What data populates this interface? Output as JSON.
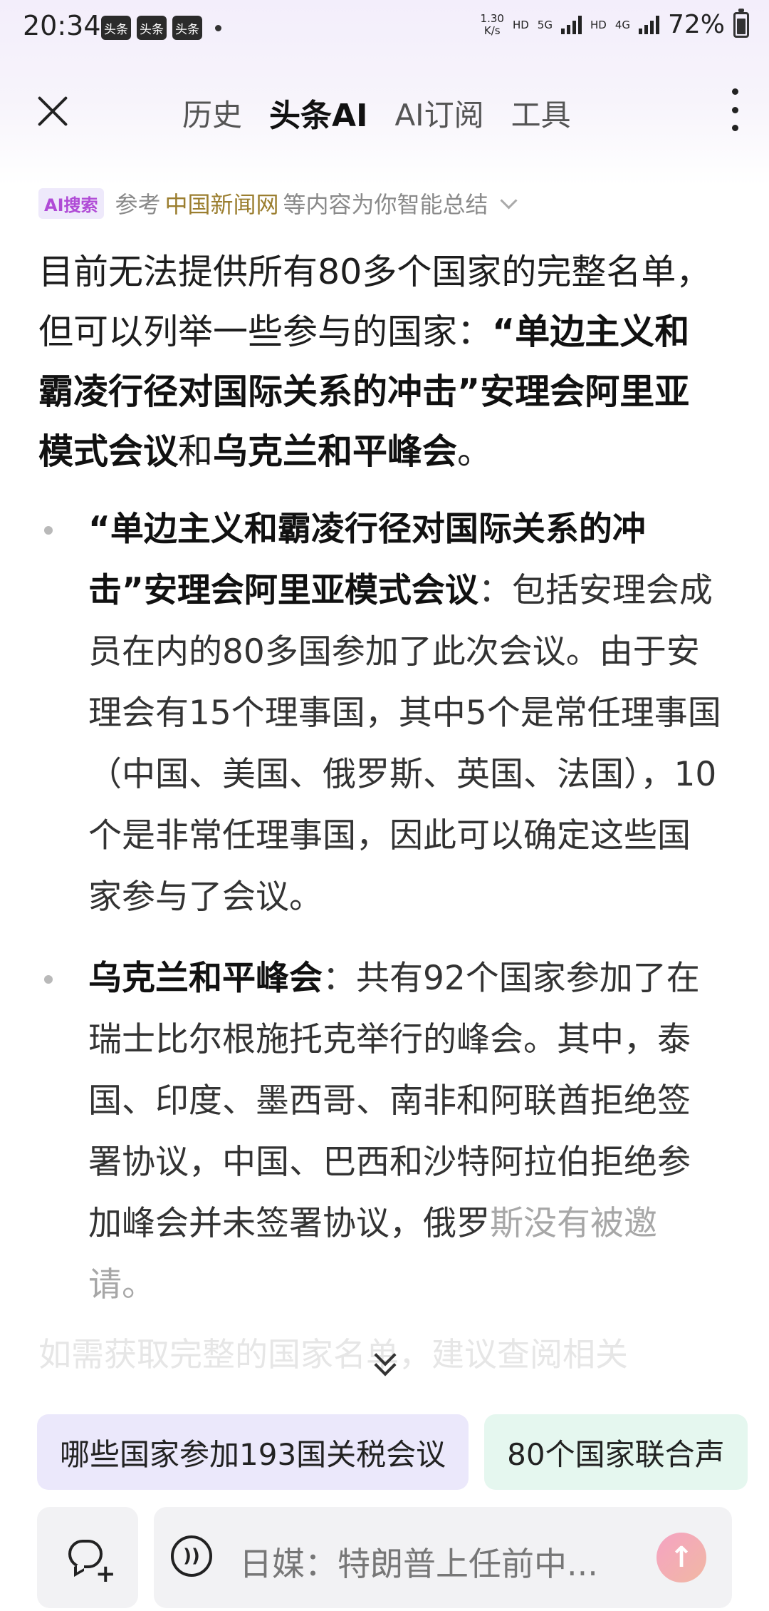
{
  "status": {
    "time": "20:34",
    "apps": [
      "头条",
      "头条",
      "头条"
    ],
    "net_speed_value": "1.30",
    "net_speed_unit": "K/s",
    "hd1": "HD",
    "sig1": "5G",
    "hd2": "HD",
    "sig2": "4G",
    "battery": "72%"
  },
  "nav": {
    "tabs": [
      "历史",
      "头条AI",
      "AI订阅",
      "工具"
    ],
    "active_tab": "头条AI"
  },
  "source": {
    "badge": "AI搜索",
    "prefix": "参考",
    "name": "中国新闻网",
    "suffix": "等内容为你智能总结"
  },
  "answer": {
    "intro": "目前无法提供所有80多个国家的完整名单，但可以列举一些参与的国家：",
    "bold1": "“单边主义和霸凌行径对国际关系的冲击”安理会阿里亚模式会议",
    "connector": "和",
    "bold2": "乌克兰和平峰会",
    "end": "。",
    "items": [
      {
        "title": "“单边主义和霸凌行径对国际关系的冲击”安理会阿里亚模式会议",
        "sep": "：",
        "text": "包括安理会成员在内的80多国参加了此次会议。由于安理会有15个理事国，其中5个是常任理事国（中国、美国、俄罗斯、英国、法国），10个是非常任理事国，因此可以确定这些国家参与了会议。"
      },
      {
        "title": "乌克兰和平峰会",
        "sep": "：",
        "text": "共有92个国家参加了在瑞士比尔根施托克举行的峰会。其中，泰国、印度、墨西哥、南非和阿联酋拒绝签署协议，中国、巴西和沙特阿拉伯拒绝参加峰会并未签署协议，俄罗",
        "text_fade": "斯没有被邀请。"
      }
    ],
    "faded_line": "如需获取完整的国家名单，建议查阅相关"
  },
  "suggestions": [
    "哪些国家参加193国关税会议",
    "80个国家联合声"
  ],
  "input": {
    "query": "日媒：特朗普上任前中..."
  },
  "colors": {
    "badge_text": "#b04bd6",
    "source_name": "#9b7e2f",
    "chip1_bg": "#ebe8fb",
    "chip2_bg": "#e5f7ef"
  }
}
